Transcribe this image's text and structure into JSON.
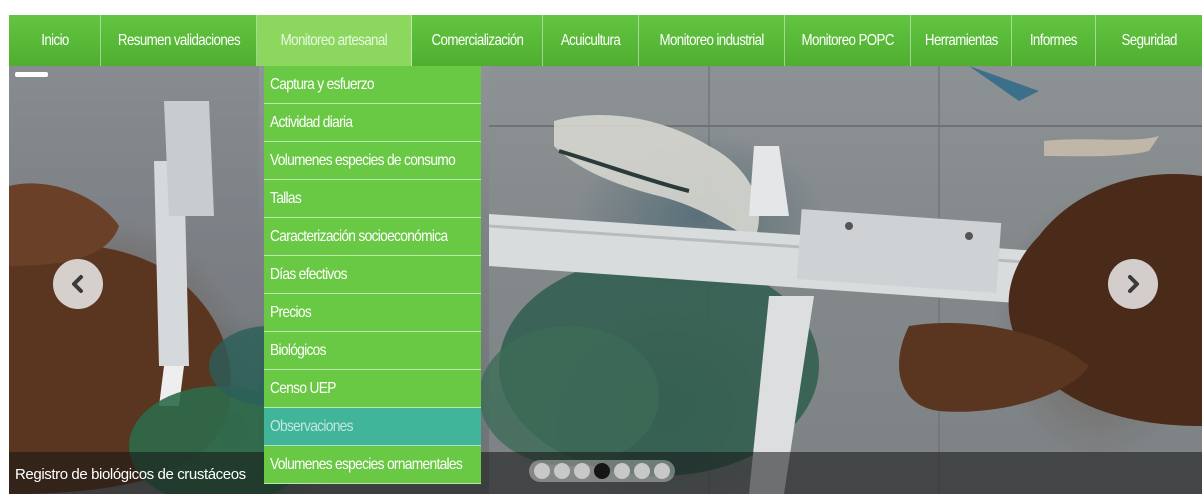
{
  "nav": {
    "items": [
      {
        "label": "Inicio"
      },
      {
        "label": "Resumen validaciones"
      },
      {
        "label": "Monitoreo artesanal"
      },
      {
        "label": "Comercialización"
      },
      {
        "label": "Acuicultura"
      },
      {
        "label": "Monitoreo industrial"
      },
      {
        "label": "Monitoreo POPC"
      },
      {
        "label": "Herramientas"
      },
      {
        "label": "Informes"
      },
      {
        "label": "Seguridad"
      }
    ],
    "active_label": "Monitoreo artesanal",
    "color": "#58b936",
    "active_color": "#8cd85f"
  },
  "dropdown": {
    "items": [
      {
        "label": "Captura y esfuerzo"
      },
      {
        "label": "Actividad diaria"
      },
      {
        "label": "Volumenes especies de consumo"
      },
      {
        "label": "Tallas"
      },
      {
        "label": "Caracterización socioeconómica"
      },
      {
        "label": "Días efectivos"
      },
      {
        "label": "Precios"
      },
      {
        "label": "Biológicos"
      },
      {
        "label": "Censo UEP"
      },
      {
        "label": "Observaciones"
      },
      {
        "label": "Volumenes especies ornamentales"
      }
    ],
    "selected_label": "Observaciones",
    "color": "#6ac944",
    "selected_color": "#40b59a"
  },
  "slider": {
    "caption": "Registro de biológicos de crustáceos",
    "prev_icon": "chevron-left-icon",
    "next_icon": "chevron-right-icon",
    "dot_count": 7,
    "active_dot": 4
  }
}
